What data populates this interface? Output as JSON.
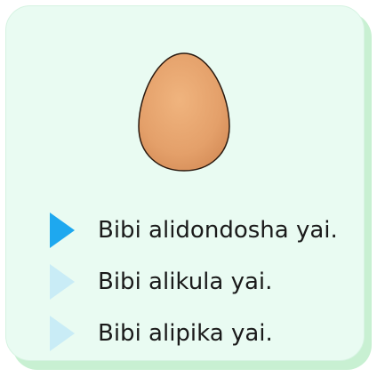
{
  "illustration": {
    "icon": "egg-illustration",
    "fill_color": "#e4a06a",
    "highlight_color": "#f0b47e"
  },
  "options": [
    {
      "label": "Bibi alidondosha yai.",
      "selected": true,
      "arrow_color": "#1ea8ef"
    },
    {
      "label": "Bibi alikula yai.",
      "selected": false,
      "arrow_color": "#c9ecf6"
    },
    {
      "label": "Bibi alipika yai.",
      "selected": false,
      "arrow_color": "#c9ecf6"
    }
  ],
  "colors": {
    "card_background": "#e9fbf2",
    "card_shadow": "#c8f0d2"
  }
}
